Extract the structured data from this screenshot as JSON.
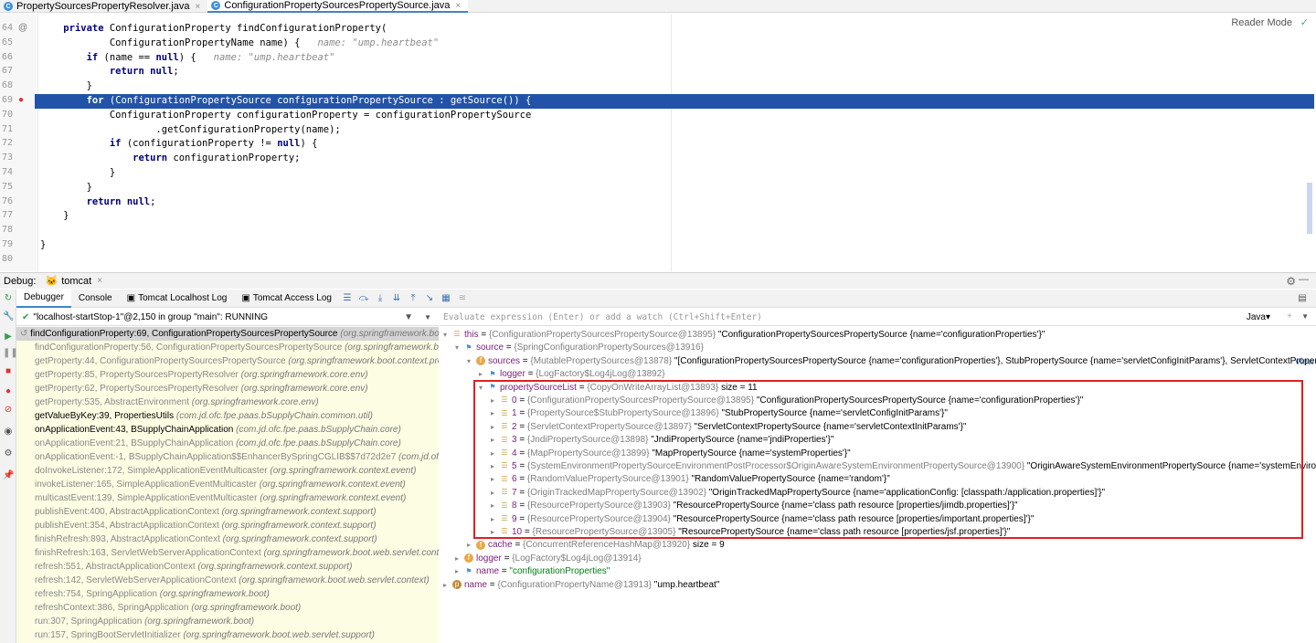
{
  "tabs": [
    {
      "label": "PropertySourcesPropertyResolver.java",
      "active": false
    },
    {
      "label": "ConfigurationPropertySourcesPropertySource.java",
      "active": true
    }
  ],
  "editor": {
    "reader_mode": "Reader Mode",
    "lines": [
      {
        "num": "64",
        "code": "    private ConfigurationProperty findConfigurationProperty(",
        "hint": ""
      },
      {
        "num": "65",
        "code": "            ConfigurationPropertyName name) {",
        "hint": "name: \"ump.heartbeat\""
      },
      {
        "num": "66",
        "code": "        if (name == null) {",
        "hint": "name: \"ump.heartbeat\""
      },
      {
        "num": "67",
        "code": "            return null;",
        "hint": ""
      },
      {
        "num": "68",
        "code": "        }",
        "hint": ""
      },
      {
        "num": "69",
        "code": "        for (ConfigurationPropertySource configurationPropertySource : getSource()) {",
        "hint": ""
      },
      {
        "num": "70",
        "code": "            ConfigurationProperty configurationProperty = configurationPropertySource",
        "hint": ""
      },
      {
        "num": "71",
        "code": "                    .getConfigurationProperty(name);",
        "hint": ""
      },
      {
        "num": "72",
        "code": "            if (configurationProperty != null) {",
        "hint": ""
      },
      {
        "num": "73",
        "code": "                return configurationProperty;",
        "hint": ""
      },
      {
        "num": "74",
        "code": "            }",
        "hint": ""
      },
      {
        "num": "75",
        "code": "        }",
        "hint": ""
      },
      {
        "num": "76",
        "code": "        return null;",
        "hint": ""
      },
      {
        "num": "77",
        "code": "    }",
        "hint": ""
      },
      {
        "num": "78",
        "code": "",
        "hint": ""
      },
      {
        "num": "79",
        "code": "}",
        "hint": ""
      },
      {
        "num": "80",
        "code": "",
        "hint": ""
      }
    ]
  },
  "debug": {
    "title": "Debug:",
    "session": "tomcat",
    "tabs": [
      "Debugger",
      "Console",
      "Tomcat Localhost Log",
      "Tomcat Access Log"
    ],
    "thread": "\"localhost-startStop-1\"@2,150 in group \"main\": RUNNING",
    "eval_placeholder": "Evaluate expression (Enter) or add a watch (Ctrl+Shift+Enter)",
    "lang": "Java",
    "frames": [
      {
        "method": "findConfigurationProperty:69, ConfigurationPropertySourcesPropertySource",
        "pkg": "(org.springframework.boot.",
        "style": "sel"
      },
      {
        "method": "findConfigurationProperty:56, ConfigurationPropertySourcesPropertySource",
        "pkg": "(org.springframework.boot.",
        "style": ""
      },
      {
        "method": "getProperty:44, ConfigurationPropertySourcesPropertySource",
        "pkg": "(org.springframework.boot.context.prope",
        "style": ""
      },
      {
        "method": "getProperty:85, PropertySourcesPropertyResolver",
        "pkg": "(org.springframework.core.env)",
        "style": ""
      },
      {
        "method": "getProperty:62, PropertySourcesPropertyResolver",
        "pkg": "(org.springframework.core.env)",
        "style": ""
      },
      {
        "method": "getProperty:535, AbstractEnvironment",
        "pkg": "(org.springframework.core.env)",
        "style": ""
      },
      {
        "method": "getValueByKey:39, PropertiesUtils",
        "pkg": "(com.jd.ofc.fpe.paas.bSupplyChain.common.util)",
        "style": "dark"
      },
      {
        "method": "onApplicationEvent:43, BSupplyChainApplication",
        "pkg": "(com.jd.ofc.fpe.paas.bSupplyChain.core)",
        "style": "dark"
      },
      {
        "method": "onApplicationEvent:21, BSupplyChainApplication",
        "pkg": "(com.jd.ofc.fpe.paas.bSupplyChain.core)",
        "style": ""
      },
      {
        "method": "onApplicationEvent:-1, BSupplyChainApplication$$EnhancerBySpringCGLIB$$7d72d2e7",
        "pkg": "(com.jd.ofc.fpe.pa",
        "style": ""
      },
      {
        "method": "doInvokeListener:172, SimpleApplicationEventMulticaster",
        "pkg": "(org.springframework.context.event)",
        "style": ""
      },
      {
        "method": "invokeListener:165, SimpleApplicationEventMulticaster",
        "pkg": "(org.springframework.context.event)",
        "style": ""
      },
      {
        "method": "multicastEvent:139, SimpleApplicationEventMulticaster",
        "pkg": "(org.springframework.context.event)",
        "style": ""
      },
      {
        "method": "publishEvent:400, AbstractApplicationContext",
        "pkg": "(org.springframework.context.support)",
        "style": ""
      },
      {
        "method": "publishEvent:354, AbstractApplicationContext",
        "pkg": "(org.springframework.context.support)",
        "style": ""
      },
      {
        "method": "finishRefresh:893, AbstractApplicationContext",
        "pkg": "(org.springframework.context.support)",
        "style": ""
      },
      {
        "method": "finishRefresh:163, ServletWebServerApplicationContext",
        "pkg": "(org.springframework.boot.web.servlet.context)",
        "style": ""
      },
      {
        "method": "refresh:551, AbstractApplicationContext",
        "pkg": "(org.springframework.context.support)",
        "style": ""
      },
      {
        "method": "refresh:142, ServletWebServerApplicationContext",
        "pkg": "(org.springframework.boot.web.servlet.context)",
        "style": ""
      },
      {
        "method": "refresh:754, SpringApplication",
        "pkg": "(org.springframework.boot)",
        "style": ""
      },
      {
        "method": "refreshContext:386, SpringApplication",
        "pkg": "(org.springframework.boot)",
        "style": ""
      },
      {
        "method": "run:307, SpringApplication",
        "pkg": "(org.springframework.boot)",
        "style": ""
      },
      {
        "method": "run:157, SpringBootServletInitializer",
        "pkg": "(org.springframework.boot.web.servlet.support)",
        "style": ""
      }
    ],
    "view_link": "View",
    "variables": [
      {
        "indent": 0,
        "tw": "▾",
        "icon": "list",
        "name": "this",
        "ref": "{ConfigurationPropertySourcesPropertySource@13895}",
        "val": "\"ConfigurationPropertySourcesPropertySource {name='configurationProperties'}\""
      },
      {
        "indent": 1,
        "tw": "▾",
        "icon": "flag",
        "name": "source",
        "ref": "{SpringConfigurationPropertySources@13916}",
        "val": ""
      },
      {
        "indent": 2,
        "tw": "▾",
        "icon": "f",
        "name": "sources",
        "ref": "{MutablePropertySources@13878}",
        "val": "\"[ConfigurationPropertySourcesPropertySource {name='configurationProperties'}, StubPropertySource {name='servletConfigInitParams'}, ServletContextPropert..."
      },
      {
        "indent": 3,
        "tw": "▸",
        "icon": "flag",
        "name": "logger",
        "ref": "{LogFactory$Log4jLog@13892}",
        "val": ""
      },
      {
        "indent": 3,
        "tw": "▾",
        "icon": "flag",
        "name": "propertySourceList",
        "ref": "{CopyOnWriteArrayList@13893}",
        "val": " size = 11"
      },
      {
        "indent": 4,
        "tw": "▸",
        "icon": "list",
        "name": "0",
        "ref": "{ConfigurationPropertySourcesPropertySource@13895}",
        "val": "\"ConfigurationPropertySourcesPropertySource {name='configurationProperties'}\""
      },
      {
        "indent": 4,
        "tw": "▸",
        "icon": "list",
        "name": "1",
        "ref": "{PropertySource$StubPropertySource@13896}",
        "val": "\"StubPropertySource {name='servletConfigInitParams'}\""
      },
      {
        "indent": 4,
        "tw": "▸",
        "icon": "list",
        "name": "2",
        "ref": "{ServletContextPropertySource@13897}",
        "val": "\"ServletContextPropertySource {name='servletContextInitParams'}\""
      },
      {
        "indent": 4,
        "tw": "▸",
        "icon": "list",
        "name": "3",
        "ref": "{JndiPropertySource@13898}",
        "val": "\"JndiPropertySource {name='jndiProperties'}\""
      },
      {
        "indent": 4,
        "tw": "▸",
        "icon": "list",
        "name": "4",
        "ref": "{MapPropertySource@13899}",
        "val": "\"MapPropertySource {name='systemProperties'}\""
      },
      {
        "indent": 4,
        "tw": "▸",
        "icon": "list",
        "name": "5",
        "ref": "{SystemEnvironmentPropertySourceEnvironmentPostProcessor$OriginAwareSystemEnvironmentPropertySource@13900}",
        "val": "\"OriginAwareSystemEnvironmentPropertySource {name='systemEnvironment'}\""
      },
      {
        "indent": 4,
        "tw": "▸",
        "icon": "list",
        "name": "6",
        "ref": "{RandomValuePropertySource@13901}",
        "val": "\"RandomValuePropertySource {name='random'}\""
      },
      {
        "indent": 4,
        "tw": "▸",
        "icon": "list",
        "name": "7",
        "ref": "{OriginTrackedMapPropertySource@13902}",
        "val": "\"OriginTrackedMapPropertySource {name='applicationConfig: [classpath:/application.properties]'}\""
      },
      {
        "indent": 4,
        "tw": "▸",
        "icon": "list",
        "name": "8",
        "ref": "{ResourcePropertySource@13903}",
        "val": "\"ResourcePropertySource {name='class path resource [properties/jimdb.properties]'}\""
      },
      {
        "indent": 4,
        "tw": "▸",
        "icon": "list",
        "name": "9",
        "ref": "{ResourcePropertySource@13904}",
        "val": "\"ResourcePropertySource {name='class path resource [properties/important.properties]'}\""
      },
      {
        "indent": 4,
        "tw": "▸",
        "icon": "list",
        "name": "10",
        "ref": "{ResourcePropertySource@13905}",
        "val": "\"ResourcePropertySource {name='class path resource [properties/jsf.properties]'}\""
      },
      {
        "indent": 2,
        "tw": "▸",
        "icon": "f",
        "name": "cache",
        "ref": "{ConcurrentReferenceHashMap@13920}",
        "val": " size = 9"
      },
      {
        "indent": 1,
        "tw": "▸",
        "icon": "f",
        "name": "logger",
        "ref": "{LogFactory$Log4jLog@13914}",
        "val": ""
      },
      {
        "indent": 1,
        "tw": "▸",
        "icon": "flag",
        "name": "name",
        "ref": "",
        "val": "\"configurationProperties\""
      },
      {
        "indent": 0,
        "tw": "▸",
        "icon": "p",
        "name": "name",
        "ref": "{ConfigurationPropertyName@13913}",
        "val": "\"ump.heartbeat\""
      }
    ]
  }
}
